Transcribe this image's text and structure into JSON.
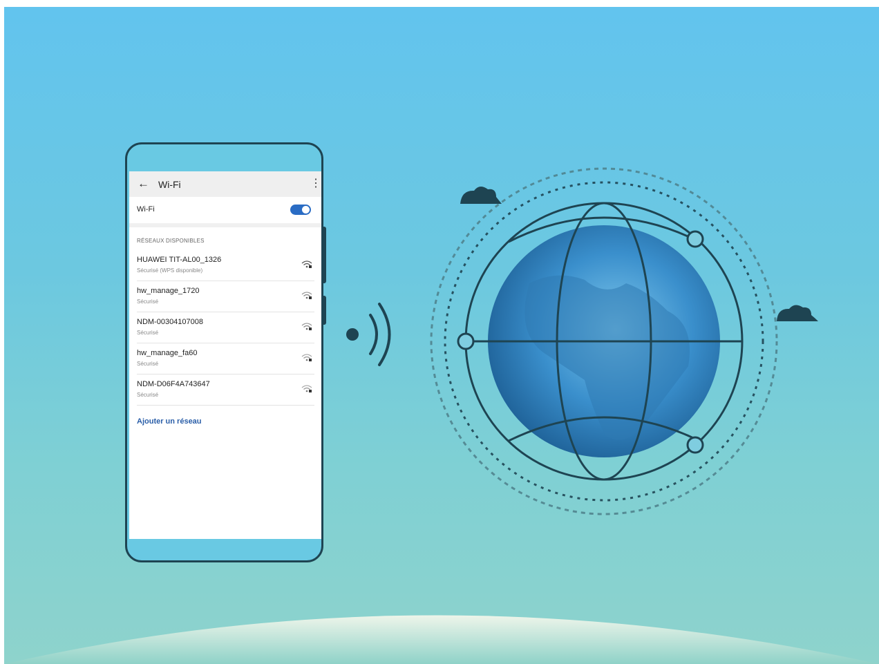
{
  "header": {
    "title": "Wi-Fi"
  },
  "wifi_toggle": {
    "label": "Wi-Fi",
    "on": true
  },
  "section_title": "RÉSEAUX DISPONIBLES",
  "networks": [
    {
      "name": "HUAWEI TIT-AL00_1326",
      "status": "Sécurisé (WPS disponible)"
    },
    {
      "name": "hw_manage_1720",
      "status": "Sécurisé"
    },
    {
      "name": "NDM-00304107008",
      "status": "Sécurisé"
    },
    {
      "name": "hw_manage_fa60",
      "status": "Sécurisé"
    },
    {
      "name": "NDM-D06F4A743647",
      "status": "Sécurisé"
    }
  ],
  "add_network": "Ajouter un réseau",
  "icons": {
    "back": "back-arrow-icon",
    "more": "more-vert-icon",
    "wifi": "wifi-lock-icon"
  },
  "colors": {
    "accent": "#2a6cc4",
    "outline": "#1e4452",
    "link": "#2a5ea8"
  }
}
